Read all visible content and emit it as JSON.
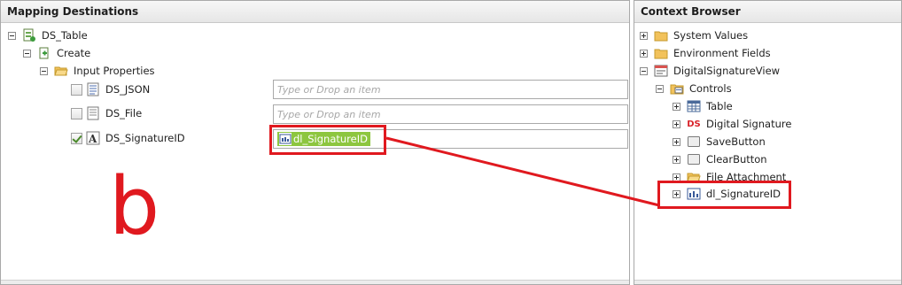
{
  "mapping": {
    "title": "Mapping Destinations",
    "tree": {
      "root_label": "DS_Table",
      "create_label": "Create",
      "input_properties_label": "Input Properties",
      "properties": [
        {
          "label": "DS_JSON",
          "checked": false,
          "placeholder": "Type or Drop an item"
        },
        {
          "label": "DS_File",
          "checked": false,
          "placeholder": "Type or Drop an item"
        },
        {
          "label": "DS_SignatureID",
          "checked": true,
          "mapped_value": "dl_SignatureID"
        }
      ]
    }
  },
  "annotation": {
    "letter": "b",
    "color": "#e0191f"
  },
  "context": {
    "title": "Context Browser",
    "items": [
      {
        "label": "System Values",
        "icon": "folder-icon"
      },
      {
        "label": "Environment Fields",
        "icon": "folder-icon"
      },
      {
        "label": "DigitalSignatureView",
        "icon": "view-icon"
      },
      {
        "label": "Controls",
        "icon": "controls-folder-icon"
      },
      {
        "label": "Table",
        "icon": "table-icon"
      },
      {
        "label": "Digital Signature",
        "icon": "ds-icon",
        "icon_text": "DS"
      },
      {
        "label": "SaveButton",
        "icon": "button-icon"
      },
      {
        "label": "ClearButton",
        "icon": "button-icon"
      },
      {
        "label": "File Attachment",
        "icon": "folder-icon"
      },
      {
        "label": "dl_SignatureID",
        "icon": "datalabel-icon"
      }
    ]
  },
  "colors": {
    "highlight": "#e0191f",
    "chip": "#8dc63f",
    "folder": "#f2c25b"
  }
}
